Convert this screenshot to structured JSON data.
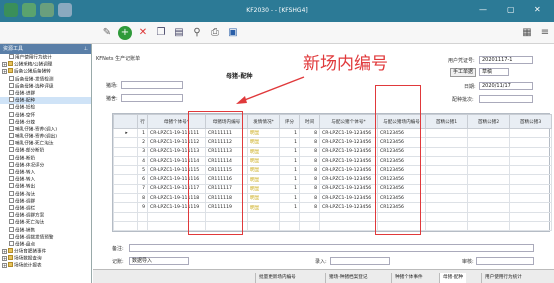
{
  "titlebar": {
    "title": "KF2030 - - [KFSHG4]"
  },
  "toolbar": {
    "items": [
      "edit-icon",
      "add-icon",
      "delete-icon",
      "copy-icon",
      "paste-icon",
      "search-icon",
      "print-icon",
      "save-icon"
    ]
  },
  "sidebar": {
    "header": "资源工具",
    "items": [
      {
        "label": "用户使用行为统计",
        "type": "doc",
        "indent": 1
      },
      {
        "label": "公猪采精/公猪调理",
        "type": "folder",
        "indent": 0
      },
      {
        "label": "后备公猪后备猪转",
        "type": "folder",
        "indent": 0
      },
      {
        "label": "后备母猪-发情检测",
        "type": "doc",
        "indent": 1
      },
      {
        "label": "后备母猪-选种评级",
        "type": "doc",
        "indent": 1
      },
      {
        "label": "母猪-进群",
        "type": "doc",
        "indent": 1
      },
      {
        "label": "母猪-配种",
        "type": "doc",
        "indent": 1,
        "selected": true
      },
      {
        "label": "母猪-妊检",
        "type": "doc",
        "indent": 1
      },
      {
        "label": "母猪-空怀",
        "type": "doc",
        "indent": 1
      },
      {
        "label": "母猪-分娩",
        "type": "doc",
        "indent": 1
      },
      {
        "label": "哺乳仔猪-寄养(调入)",
        "type": "doc",
        "indent": 1
      },
      {
        "label": "哺乳仔猪-寄养(调出)",
        "type": "doc",
        "indent": 1
      },
      {
        "label": "哺乳仔猪-死亡淘汰",
        "type": "doc",
        "indent": 1
      },
      {
        "label": "母猪-部分断奶",
        "type": "doc",
        "indent": 1
      },
      {
        "label": "母猪-断奶",
        "type": "doc",
        "indent": 1
      },
      {
        "label": "母猪-体况评分",
        "type": "doc",
        "indent": 1
      },
      {
        "label": "母猪-转入",
        "type": "doc",
        "indent": 1
      },
      {
        "label": "母猪-转入",
        "type": "doc",
        "indent": 1
      },
      {
        "label": "母猪-转出",
        "type": "doc",
        "indent": 1
      },
      {
        "label": "母猪-淘汰",
        "type": "doc",
        "indent": 1
      },
      {
        "label": "母猪-调群",
        "type": "doc",
        "indent": 1
      },
      {
        "label": "母猪-调栏",
        "type": "doc",
        "indent": 1
      },
      {
        "label": "母猪-调群方案",
        "type": "doc",
        "indent": 1
      },
      {
        "label": "母猪-死亡淘汰",
        "type": "doc",
        "indent": 1
      },
      {
        "label": "母猪-销售",
        "type": "doc",
        "indent": 1
      },
      {
        "label": "母猪-调拨发情预警",
        "type": "doc",
        "indent": 1
      },
      {
        "label": "母猪-盘点",
        "type": "doc",
        "indent": 1
      },
      {
        "label": "分场育肥猪事件",
        "type": "folder",
        "indent": 0
      },
      {
        "label": "场场数据查询",
        "type": "folder",
        "indent": 0
      },
      {
        "label": "场场统计报表",
        "type": "folder",
        "indent": 0
      }
    ]
  },
  "main": {
    "doc_code": "KFNets 生产记账单",
    "title": "母猪-配种",
    "annotation": "新场内编号",
    "fields": {
      "field1_label": "猪场:",
      "field2_label": "猪舍:",
      "user_label": "用户凭证号:",
      "user_value": "20201117-1",
      "manual_btn": "手工单据",
      "status": "草稿",
      "date_label": "日期:",
      "date_value": "2020/11/17",
      "seq_label": "配种批次:"
    },
    "columns": [
      "行",
      "母猪个体号*",
      "母猪场内编号",
      "发情情况*",
      "评分",
      "时间",
      "与配公猪个体号*",
      "与配公猪场内编号",
      "首精公猪1",
      "首精公猪2",
      "首精公猪3"
    ],
    "rows": [
      [
        "1",
        "CR-LPZC1-19-111111",
        "CR111111",
        "明显",
        "1",
        "8",
        "CR-LPZC1-19-123456",
        "CR123456"
      ],
      [
        "2",
        "CR-LPZC1-19-111112",
        "CR111112",
        "明显",
        "1",
        "8",
        "CR-LPZC1-19-123456",
        "CR123456"
      ],
      [
        "3",
        "CR-LPZC1-19-111113",
        "CR111113",
        "明显",
        "1",
        "8",
        "CR-LPZC1-19-123456",
        "CR123456"
      ],
      [
        "4",
        "CR-LPZC1-19-111114",
        "CR111114",
        "明显",
        "1",
        "8",
        "CR-LPZC1-19-123456",
        "CR123456"
      ],
      [
        "5",
        "CR-LPZC1-19-111115",
        "CR111115",
        "明显",
        "1",
        "8",
        "CR-LPZC1-19-123456",
        "CR123456"
      ],
      [
        "6",
        "CR-LPZC1-19-111116",
        "CR111116",
        "明显",
        "1",
        "8",
        "CR-LPZC1-19-123456",
        "CR123456"
      ],
      [
        "7",
        "CR-LPZC1-19-111117",
        "CR111117",
        "明显",
        "1",
        "8",
        "CR-LPZC1-19-123456",
        "CR123456"
      ],
      [
        "8",
        "CR-LPZC1-19-111118",
        "CR111118",
        "明显",
        "1",
        "8",
        "CR-LPZC1-19-123456",
        "CR123456"
      ],
      [
        "9",
        "CR-LPZC1-19-111119",
        "CR111119",
        "明显",
        "1",
        "8",
        "CR-LPZC1-19-123456",
        "CR123456"
      ]
    ],
    "bottom": {
      "note_label": "备注:",
      "record_label": "记账:",
      "record_value": "数据导入",
      "enter_label": "录入:",
      "enter_value": "",
      "review_label": "审核:"
    }
  },
  "statusbar": {
    "tabs": [
      "批量更新场内编号",
      "猪场-种猪档案登记",
      "种猪个体事件",
      "母猪-配种",
      "用户使用行为统计"
    ]
  },
  "colors": {
    "titlebar": "#2c7a96",
    "annotation": "#e0393b",
    "highlight": "#c6a300"
  }
}
